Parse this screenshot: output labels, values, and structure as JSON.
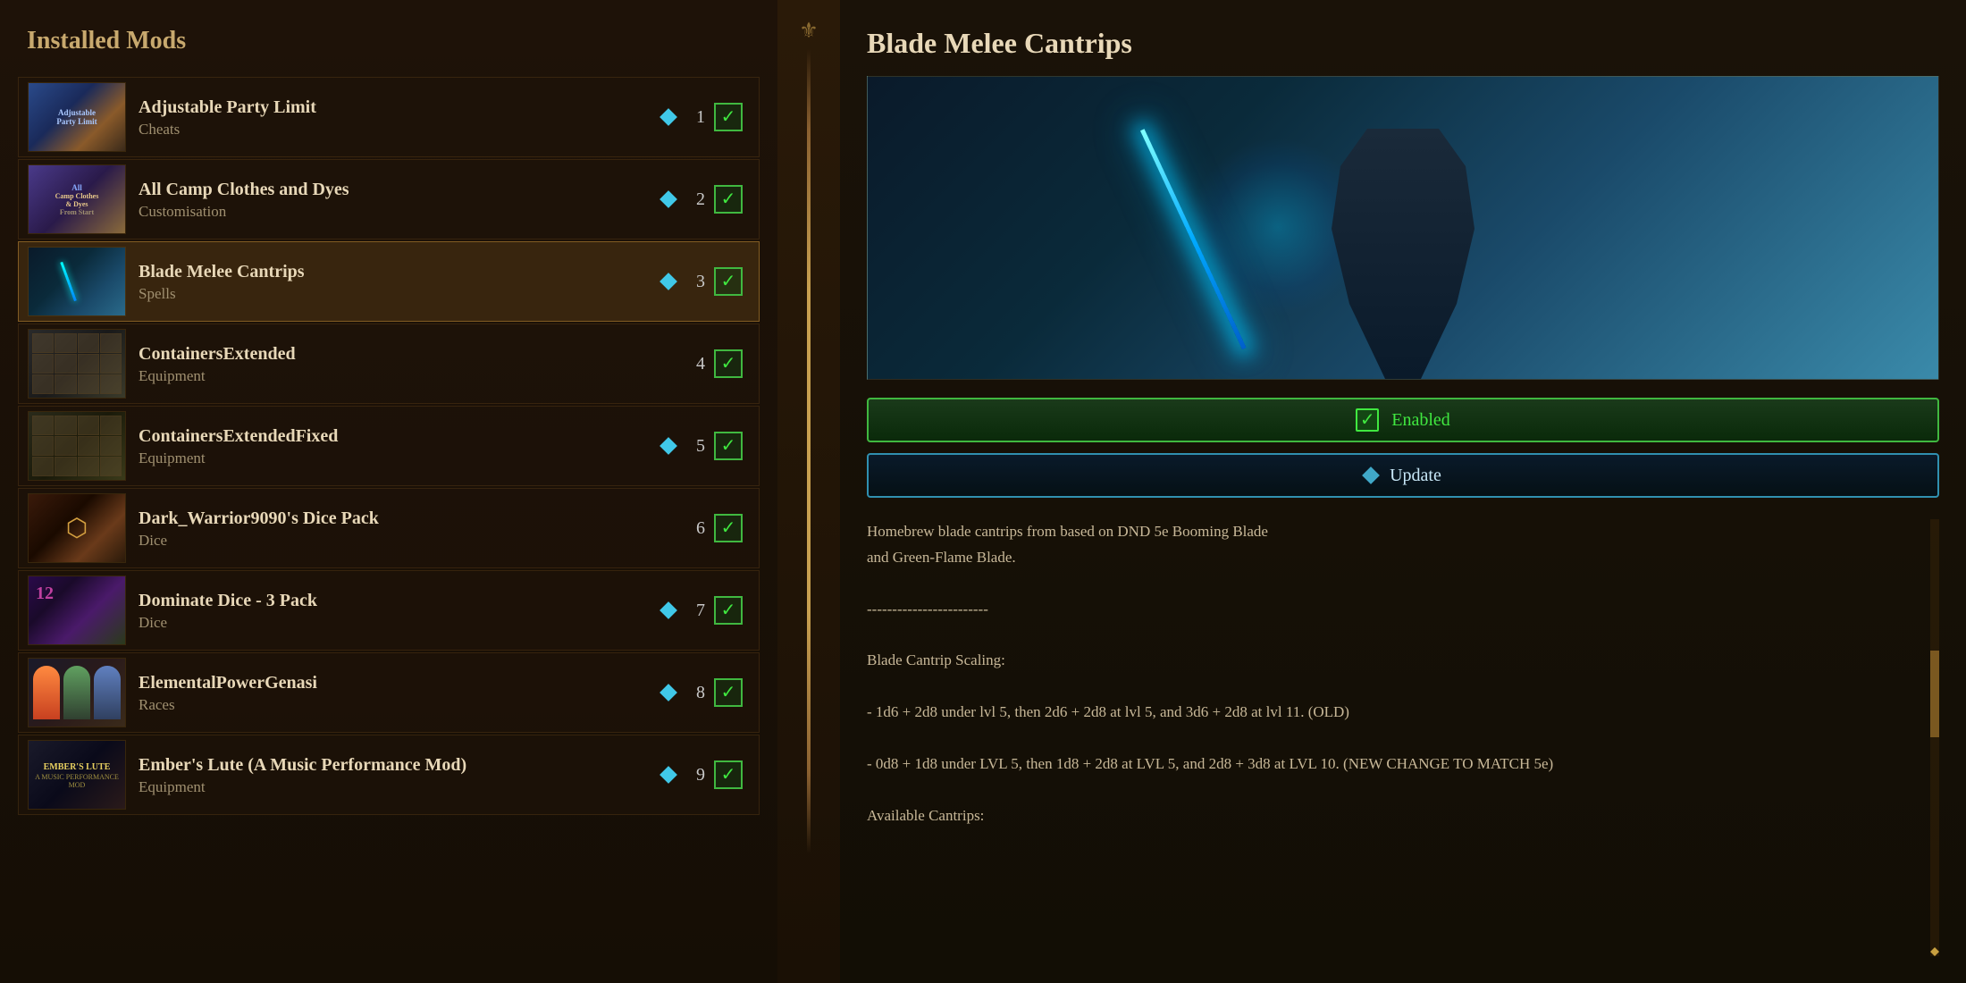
{
  "leftPanel": {
    "title": "Installed Mods",
    "mods": [
      {
        "id": 1,
        "name": "Adjustable Party Limit",
        "category": "Cheats",
        "number": "1",
        "hasDiamond": true,
        "checked": true,
        "selected": false,
        "thumbType": "party-limit"
      },
      {
        "id": 2,
        "name": "All Camp Clothes and Dyes",
        "category": "Customisation",
        "number": "2",
        "hasDiamond": true,
        "checked": true,
        "selected": false,
        "thumbType": "camp-clothes"
      },
      {
        "id": 3,
        "name": "Blade Melee Cantrips",
        "category": "Spells",
        "number": "3",
        "hasDiamond": true,
        "checked": true,
        "selected": true,
        "thumbType": "blade-cantrips"
      },
      {
        "id": 4,
        "name": "ContainersExtended",
        "category": "Equipment",
        "number": "4",
        "hasDiamond": false,
        "checked": true,
        "selected": false,
        "thumbType": "containers"
      },
      {
        "id": 5,
        "name": "ContainersExtendedFixed",
        "category": "Equipment",
        "number": "5",
        "hasDiamond": true,
        "checked": true,
        "selected": false,
        "thumbType": "containers-fixed"
      },
      {
        "id": 6,
        "name": "Dark_Warrior9090's Dice Pack",
        "category": "Dice",
        "number": "6",
        "hasDiamond": false,
        "checked": true,
        "selected": false,
        "thumbType": "dice-dark"
      },
      {
        "id": 7,
        "name": "Dominate Dice - 3 Pack",
        "category": "Dice",
        "number": "7",
        "hasDiamond": true,
        "checked": true,
        "selected": false,
        "thumbType": "dominate-dice"
      },
      {
        "id": 8,
        "name": "ElementalPowerGenasi",
        "category": "Races",
        "number": "8",
        "hasDiamond": true,
        "checked": true,
        "selected": false,
        "thumbType": "genasi"
      },
      {
        "id": 9,
        "name": "Ember's Lute (A Music Performance Mod)",
        "category": "Equipment",
        "number": "9",
        "hasDiamond": true,
        "checked": true,
        "selected": false,
        "thumbType": "ember"
      }
    ]
  },
  "rightPanel": {
    "title": "Blade Melee Cantrips",
    "enabledLabel": "Enabled",
    "updateLabel": "Update",
    "description": {
      "line1": "Homebrew blade cantrips from based on DND 5e Booming Blade",
      "line2": "and Green-Flame Blade.",
      "separator": "------------------------",
      "scaling_title": "Blade Cantrip Scaling:",
      "scaling_old": "- 1d6 + 2d8 under lvl 5, then 2d6 + 2d8 at lvl 5, and 3d6 + 2d8 at lvl 11. (OLD)",
      "scaling_new": "- 0d8 + 1d8 under LVL 5, then 1d8 + 2d8 at LVL 5, and 2d8 + 3d8 at LVL 10. (NEW CHANGE TO MATCH 5e)",
      "available_title": "Available Cantrips:"
    }
  }
}
